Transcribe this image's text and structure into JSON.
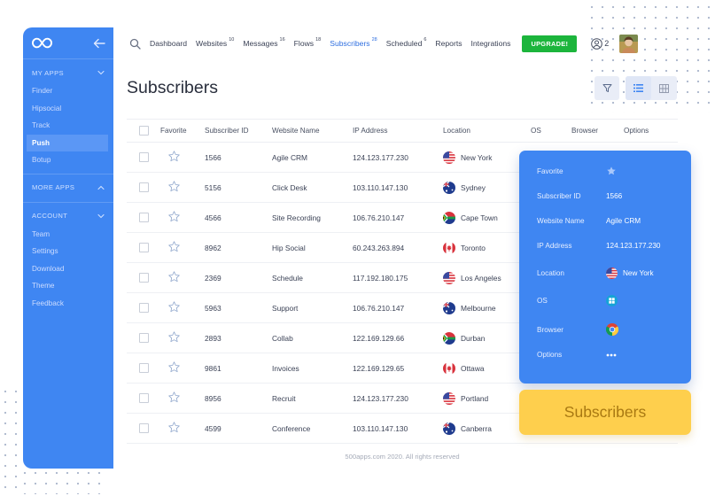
{
  "sidebar": {
    "sections": [
      {
        "label": "MY APPS",
        "items": [
          "Finder",
          "Hipsocial",
          "Track",
          "Push",
          "Botup"
        ]
      },
      {
        "label": "MORE APPS",
        "items": []
      },
      {
        "label": "ACCOUNT",
        "items": [
          "Team",
          "Settings",
          "Download",
          "Theme",
          "Feedback"
        ]
      }
    ],
    "active_item": "Push"
  },
  "nav": {
    "items": [
      {
        "label": "Dashboard",
        "count": ""
      },
      {
        "label": "Websites",
        "count": "10"
      },
      {
        "label": "Messages",
        "count": "16"
      },
      {
        "label": "Flows",
        "count": "18"
      },
      {
        "label": "Subscribers",
        "count": "28"
      },
      {
        "label": "Scheduled",
        "count": "6"
      },
      {
        "label": "Reports",
        "count": ""
      },
      {
        "label": "Integrations",
        "count": ""
      }
    ],
    "active": "Subscribers",
    "upgrade_label": "UPGRADE!",
    "user_count": "2"
  },
  "page": {
    "title": "Subscribers",
    "footer": "500apps.com 2020. All rights reserved"
  },
  "table": {
    "columns": [
      "Favorite",
      "Subscriber ID",
      "Website Name",
      "IP Address",
      "Location",
      "OS",
      "Browser",
      "Options"
    ],
    "rows": [
      {
        "id": "1566",
        "site": "Agile CRM",
        "ip": "124.123.177.230",
        "location": "New York",
        "flag": "us"
      },
      {
        "id": "5156",
        "site": "Click Desk",
        "ip": "103.110.147.130",
        "location": "Sydney",
        "flag": "au"
      },
      {
        "id": "4566",
        "site": "Site Recording",
        "ip": "106.76.210.147",
        "location": "Cape Town",
        "flag": "za"
      },
      {
        "id": "8962",
        "site": "Hip Social",
        "ip": "60.243.263.894",
        "location": "Toronto",
        "flag": "ca"
      },
      {
        "id": "2369",
        "site": "Schedule",
        "ip": "117.192.180.175",
        "location": "Los Angeles",
        "flag": "us"
      },
      {
        "id": "5963",
        "site": "Support",
        "ip": "106.76.210.147",
        "location": "Melbourne",
        "flag": "au"
      },
      {
        "id": "2893",
        "site": "Collab",
        "ip": "122.169.129.66",
        "location": "Durban",
        "flag": "za"
      },
      {
        "id": "9861",
        "site": "Invoices",
        "ip": "122.169.129.65",
        "location": "Ottawa",
        "flag": "ca"
      },
      {
        "id": "8956",
        "site": "Recruit",
        "ip": "124.123.177.230",
        "location": "Portland",
        "flag": "us"
      },
      {
        "id": "4599",
        "site": "Conference",
        "ip": "103.110.147.130",
        "location": "Canberra",
        "flag": "au"
      }
    ]
  },
  "detail": {
    "favorite_label": "Favorite",
    "id_label": "Subscriber ID",
    "id_value": "1566",
    "site_label": "Website Name",
    "site_value": "Agile CRM",
    "ip_label": "IP Address",
    "ip_value": "124.123.177.230",
    "location_label": "Location",
    "location_value": "New York",
    "os_label": "OS",
    "os_icon": "windows-icon",
    "browser_label": "Browser",
    "browser_icon": "chrome-icon",
    "options_label": "Options"
  },
  "badge": {
    "label": "Subscribers"
  },
  "colors": {
    "primary": "#3f86f2",
    "upgrade": "#1cb53c",
    "badge": "#fecf4d",
    "badge_text": "#a97912"
  }
}
